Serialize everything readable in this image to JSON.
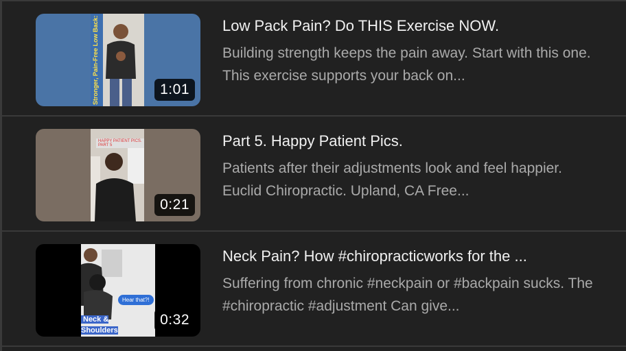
{
  "videos": [
    {
      "title": "Low Pack Pain? Do THIS Exercise NOW.",
      "description": "Building strength keeps the pain away. Start with this one. This exercise supports your back on...",
      "duration": "1:01",
      "thumbnail_text": "Stronger, Pain-Free Low Back: Modified Deadlift",
      "thumbnail_bg": "#4a74a6"
    },
    {
      "title": "Part 5. Happy Patient Pics.",
      "description": "Patients after their adjustments look and feel happier. Euclid Chiropractic. Upland, CA Free...",
      "duration": "0:21",
      "thumbnail_text": "HAPPY PATIENT PICS. PART 5",
      "thumbnail_bg": "#7a6d62"
    },
    {
      "title": "Neck Pain? How #chiropracticworks for the ...",
      "description": "Suffering from chronic #neckpain or #backpain sucks. The #chiropractic #adjustment Can give...",
      "duration": "0:32",
      "thumbnail_text": "Neck & Shoulders Adjustments",
      "thumbnail_bubble": "Hear that?!",
      "thumbnail_bg": "#000000"
    }
  ]
}
